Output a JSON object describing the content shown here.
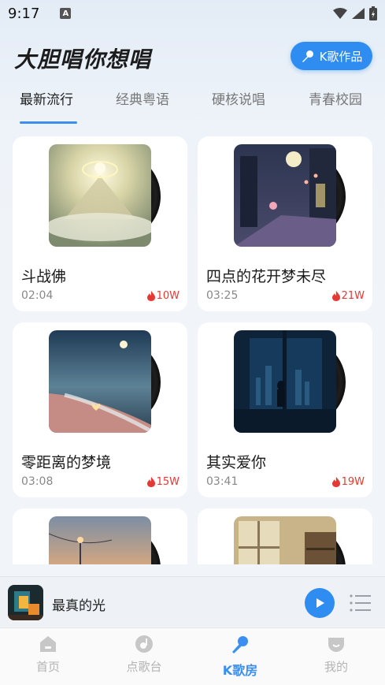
{
  "status_bar": {
    "time": "9:17",
    "notification_icon": "A"
  },
  "header": {
    "title": "大胆唱你想唱",
    "works_button_label": "K歌作品",
    "works_button_icon": "microphone-icon"
  },
  "tabs": [
    {
      "label": "最新流行",
      "active": true
    },
    {
      "label": "经典粤语",
      "active": false
    },
    {
      "label": "硬核说唱",
      "active": false
    },
    {
      "label": "青春校园",
      "active": false
    }
  ],
  "songs": [
    {
      "title": "斗战佛",
      "duration": "02:04",
      "heat": "10W"
    },
    {
      "title": "四点的花开梦未尽",
      "duration": "03:25",
      "heat": "21W"
    },
    {
      "title": "零距离的梦境",
      "duration": "03:08",
      "heat": "15W"
    },
    {
      "title": "其实爱你",
      "duration": "03:41",
      "heat": "19W"
    },
    {
      "title": "",
      "duration": "",
      "heat": ""
    },
    {
      "title": "",
      "duration": "",
      "heat": ""
    }
  ],
  "mini_player": {
    "title": "最真的光"
  },
  "bottom_nav": [
    {
      "label": "首页",
      "icon": "home-icon",
      "active": false
    },
    {
      "label": "点歌台",
      "icon": "music-disc-icon",
      "active": false
    },
    {
      "label": "K歌房",
      "icon": "microphone-icon",
      "active": true
    },
    {
      "label": "我的",
      "icon": "profile-icon",
      "active": false
    }
  ],
  "colors": {
    "accent": "#2f8cf0",
    "heat": "#e53935",
    "inactive": "#b4b4b4"
  }
}
